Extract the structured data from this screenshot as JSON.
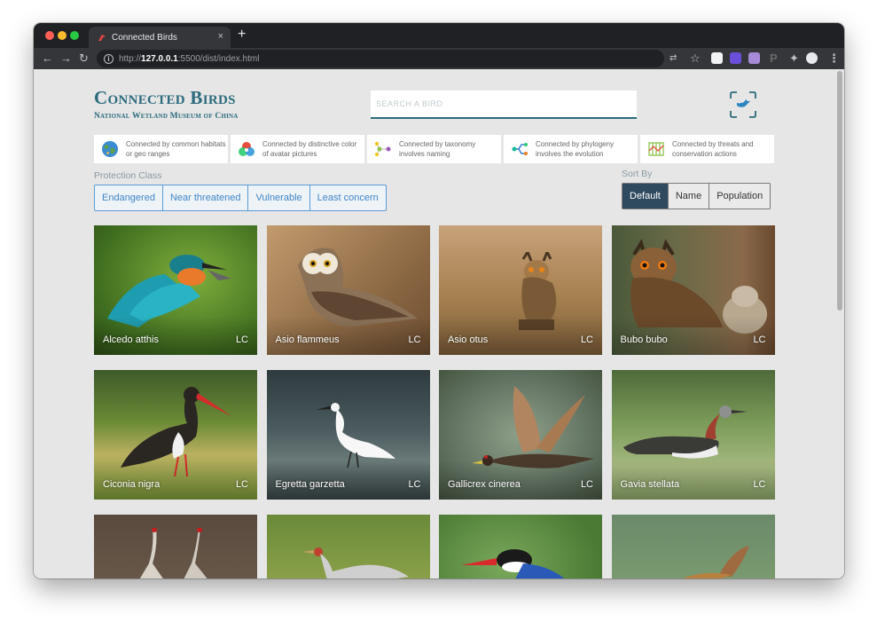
{
  "browser": {
    "tab_title": "Connected Birds",
    "tab_close": "×",
    "new_tab": "+",
    "url_scheme": "http://",
    "url_host": "127.0.0.1",
    "url_rest": ":5500/dist/index.html"
  },
  "header": {
    "title": "Connected Birds",
    "subtitle": "National Wetland Museum of China",
    "search_placeholder": "SEARCH A BIRD"
  },
  "connections": [
    {
      "icon": "globe-icon",
      "text": "Connected by common habitats or geo ranges"
    },
    {
      "icon": "color-wheel-icon",
      "text": "Connected by distinctive color of avatar pictures"
    },
    {
      "icon": "taxonomy-icon",
      "text": "Connected by taxonomy involves naming"
    },
    {
      "icon": "phylogeny-icon",
      "text": "Connected by phylogeny involves the evolution"
    },
    {
      "icon": "threats-icon",
      "text": "Connected by threats and conservation actions"
    }
  ],
  "protection_class": {
    "label": "Protection Class",
    "options": [
      "Endangered",
      "Near threatened",
      "Vulnerable",
      "Least concern"
    ]
  },
  "sort_by": {
    "label": "Sort By",
    "options": [
      "Default",
      "Name",
      "Population"
    ],
    "selected": "Default"
  },
  "birds": [
    {
      "name": "Alcedo atthis",
      "status": "LC"
    },
    {
      "name": "Asio flammeus",
      "status": "LC"
    },
    {
      "name": "Asio otus",
      "status": "LC"
    },
    {
      "name": "Bubo bubo",
      "status": "LC"
    },
    {
      "name": "Ciconia nigra",
      "status": "LC"
    },
    {
      "name": "Egretta garzetta",
      "status": "LC"
    },
    {
      "name": "Gallicrex cinerea",
      "status": "LC"
    },
    {
      "name": "Gavia stellata",
      "status": "LC"
    },
    {
      "name": "",
      "status": ""
    },
    {
      "name": "",
      "status": ""
    },
    {
      "name": "",
      "status": ""
    },
    {
      "name": "",
      "status": ""
    }
  ],
  "colors": {
    "brand": "#2b6a7c",
    "accent_blue": "#3f86c7",
    "sort_active": "#2f4a5f"
  }
}
